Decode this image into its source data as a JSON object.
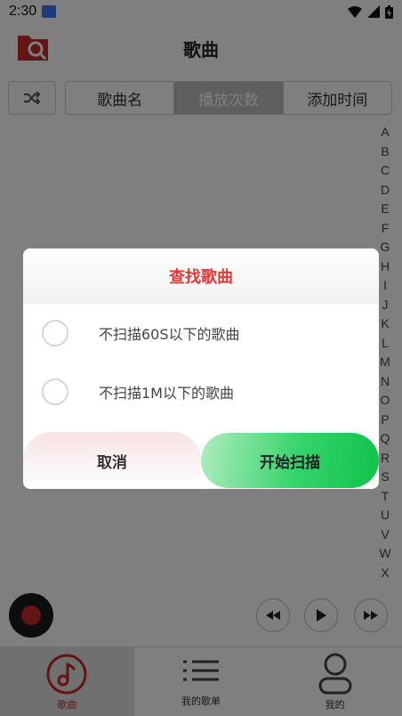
{
  "status_bar": {
    "time": "2:30"
  },
  "header": {
    "title": "歌曲"
  },
  "sort_tabs": [
    {
      "label": "歌曲名"
    },
    {
      "label": "播放次数",
      "active": true
    },
    {
      "label": "添加时间"
    }
  ],
  "alpha_index": [
    "A",
    "B",
    "C",
    "D",
    "E",
    "F",
    "G",
    "H",
    "I",
    "J",
    "K",
    "L",
    "M",
    "N",
    "O",
    "P",
    "Q",
    "R",
    "S",
    "T",
    "U",
    "V",
    "W",
    "X"
  ],
  "bottom_nav": [
    {
      "label": "歌曲",
      "icon": "music-note-icon",
      "active": true
    },
    {
      "label": "我的歌单",
      "icon": "playlist-icon"
    },
    {
      "label": "我的",
      "icon": "profile-icon"
    }
  ],
  "dialog": {
    "title": "查找歌曲",
    "options": [
      {
        "label": "不扫描60S以下的歌曲",
        "checked": false
      },
      {
        "label": "不扫描1M以下的歌曲",
        "checked": false
      }
    ],
    "cancel_label": "取消",
    "start_label": "开始扫描"
  },
  "colors": {
    "accent": "#e53935",
    "start_button": "#10c24a",
    "active_tab": "#bdbdbd"
  }
}
